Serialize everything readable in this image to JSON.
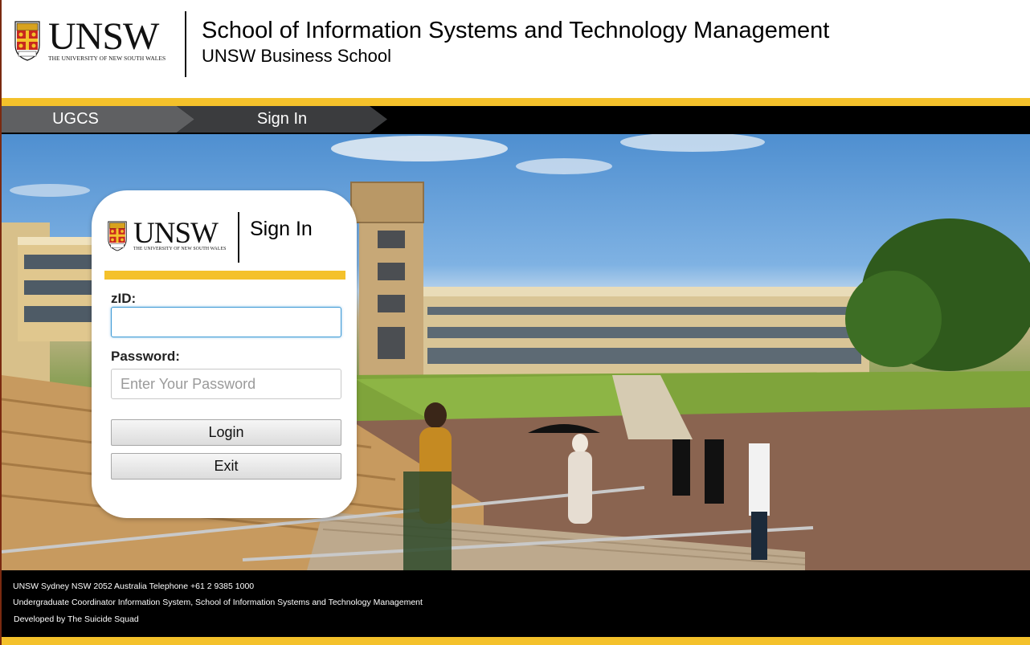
{
  "brand": {
    "wordmark": "UNSW",
    "tagline": "THE UNIVERSITY OF NEW SOUTH WALES"
  },
  "header": {
    "title": "School of Information Systems and Technology Management",
    "subtitle": "UNSW Business School"
  },
  "nav": {
    "items": [
      {
        "label": "UGCS"
      },
      {
        "label": "Sign In"
      }
    ]
  },
  "login": {
    "title": "Sign In",
    "zid_label": "zID:",
    "zid_value": "",
    "password_label": "Password:",
    "password_placeholder": "Enter Your Password",
    "login_button": "Login",
    "exit_button": "Exit"
  },
  "footer": {
    "address": "UNSW Sydney NSW 2052 Australia Telephone +61 2 9385 1000",
    "system": "Undergraduate Coordinator Information System, School of Information Systems and Technology Management",
    "developer": "Developed by The Suicide Squad"
  },
  "colors": {
    "gold": "#f4c12b",
    "nav_inactive": "#5f6062",
    "nav_active": "#3b3c3e",
    "focus_blue": "#3d9ad6"
  }
}
